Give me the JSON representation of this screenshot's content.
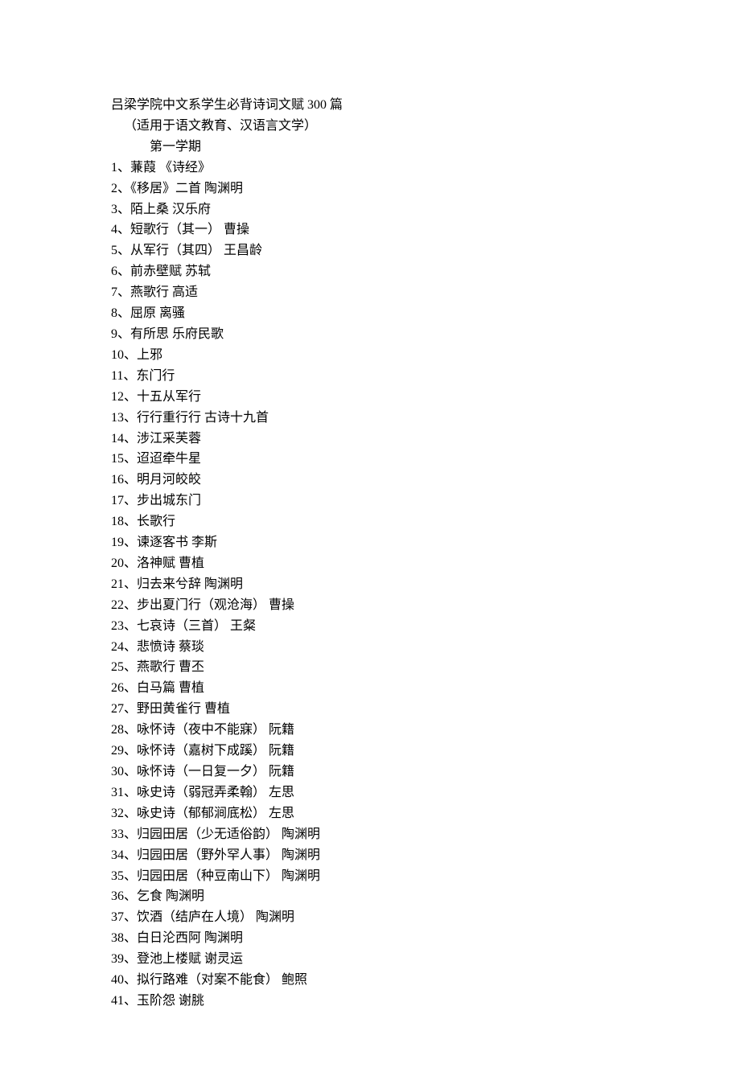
{
  "title": "吕梁学院中文系学生必背诗词文赋 300 篇",
  "subtitle": "（适用于语文教育、汉语言文学）",
  "semester": "第一学期",
  "poems": [
    "1、蒹葭  《诗经》",
    "2、《移居》二首  陶渊明",
    "3、陌上桑  汉乐府",
    "4、短歌行（其一）  曹操",
    "5、从军行（其四）  王昌龄",
    "6、前赤壁赋  苏轼",
    "7、燕歌行  高适",
    "8、屈原  离骚",
    "9、有所思  乐府民歌",
    "10、上邪",
    "11、东门行",
    "12、十五从军行",
    "13、行行重行行  古诗十九首",
    "14、涉江采芙蓉",
    "15、迢迢牵牛星",
    "16、明月河皎皎",
    "17、步出城东门",
    "18、长歌行",
    "19、谏逐客书  李斯",
    "20、洛神赋  曹植",
    "21、归去来兮辞  陶渊明",
    "22、步出夏门行（观沧海）  曹操",
    "23、七哀诗（三首）  王粲",
    "24、悲愤诗  蔡琰",
    "25、燕歌行  曹丕",
    "26、白马篇  曹植",
    "27、野田黄雀行  曹植",
    "28、咏怀诗（夜中不能寐）  阮籍",
    "29、咏怀诗（嘉树下成蹊）  阮籍",
    "30、咏怀诗（一日复一夕）  阮籍",
    "31、咏史诗（弱冠弄柔翰）  左思",
    "32、咏史诗（郁郁涧底松）  左思",
    "33、归园田居（少无适俗韵）  陶渊明",
    "34、归园田居（野外罕人事）  陶渊明",
    "35、归园田居（种豆南山下）  陶渊明",
    "36、乞食  陶渊明",
    "37、饮酒（结庐在人境）  陶渊明",
    "38、白日沦西阿  陶渊明",
    "39、登池上楼赋  谢灵运",
    "40、拟行路难（对案不能食）  鲍照",
    "41、玉阶怨  谢朓"
  ]
}
